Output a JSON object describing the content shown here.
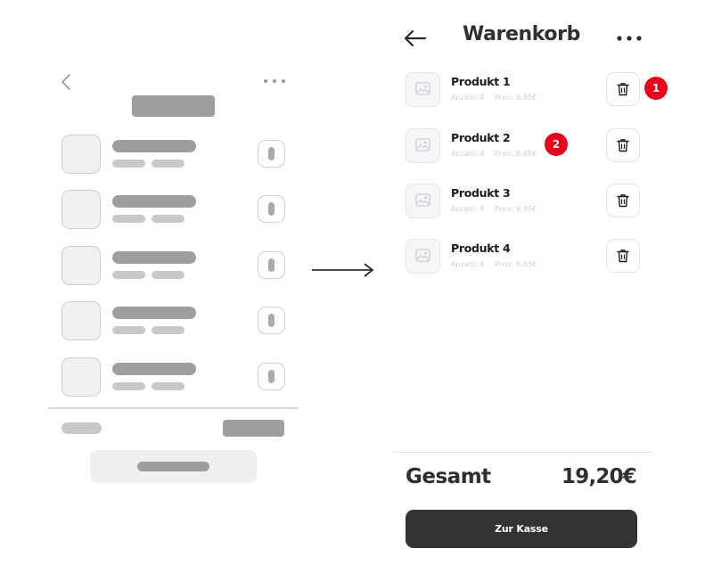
{
  "header": {
    "title": "Warenkorb"
  },
  "cart": {
    "items": [
      {
        "name": "Produkt 1",
        "quantity": "Anzahl: 4",
        "price": "Preis: 6,85€"
      },
      {
        "name": "Produkt 2",
        "quantity": "Anzahl: 4",
        "price": "Preis: 6,85€"
      },
      {
        "name": "Produkt 3",
        "quantity": "Anzahl: 4",
        "price": "Preis: 6,85€"
      },
      {
        "name": "Produkt 4",
        "quantity": "Anzahl: 4",
        "price": "Preis: 6,85€"
      }
    ]
  },
  "annotations": [
    {
      "label": "1"
    },
    {
      "label": "2"
    }
  ],
  "summary": {
    "total_label": "Gesamt",
    "total_value": "19,20€",
    "checkout_label": "Zur Kasse"
  },
  "icons": {
    "back": "arrow-left-icon",
    "more": "more-horizontal-icon",
    "thumbnail": "image-placeholder-icon",
    "delete": "trash-icon",
    "flow": "arrow-right-icon"
  },
  "colors": {
    "accent_badge": "#e8001c",
    "button_dark": "#333333",
    "text_primary": "#2f2f2f",
    "wireframe_dark": "#9e9e9e",
    "wireframe_light": "#c8c8c8"
  }
}
